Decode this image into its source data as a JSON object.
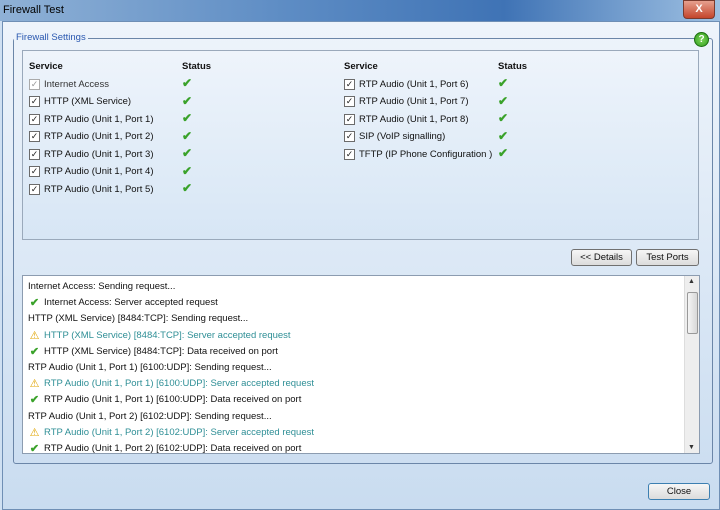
{
  "window": {
    "title": "Firewall Test",
    "close_glyph": "X"
  },
  "settings": {
    "legend": "Firewall Settings",
    "help_glyph": "?",
    "headers": {
      "service": "Service",
      "status": "Status"
    },
    "left": [
      {
        "label": "Internet Access",
        "checked": true,
        "disabled": true
      },
      {
        "label": "HTTP (XML Service)",
        "checked": true
      },
      {
        "label": "RTP Audio (Unit 1, Port 1)",
        "checked": true
      },
      {
        "label": "RTP Audio (Unit 1, Port 2)",
        "checked": true
      },
      {
        "label": "RTP Audio (Unit 1, Port 3)",
        "checked": true
      },
      {
        "label": "RTP Audio (Unit 1, Port 4)",
        "checked": true
      },
      {
        "label": "RTP Audio (Unit 1, Port 5)",
        "checked": true
      }
    ],
    "right": [
      {
        "label": "RTP Audio (Unit 1, Port 6)",
        "checked": true
      },
      {
        "label": "RTP Audio (Unit 1, Port 7)",
        "checked": true
      },
      {
        "label": "RTP Audio (Unit 1, Port 8)",
        "checked": true
      },
      {
        "label": "SIP (VoIP signalling)",
        "checked": true
      },
      {
        "label": "TFTP (IP Phone Configuration )",
        "checked": true
      }
    ]
  },
  "buttons": {
    "details": "<< Details",
    "test_ports": "Test Ports",
    "close": "Close"
  },
  "log": [
    {
      "icon": "none",
      "text": "Internet Access: Sending request..."
    },
    {
      "icon": "check",
      "text": "Internet Access: Server accepted request"
    },
    {
      "icon": "none",
      "text": "HTTP (XML Service) [8484:TCP]: Sending request..."
    },
    {
      "icon": "warning",
      "text": "HTTP (XML Service) [8484:TCP]: Server accepted request"
    },
    {
      "icon": "check",
      "text": "HTTP (XML Service) [8484:TCP]: Data received on port"
    },
    {
      "icon": "none",
      "text": "RTP Audio (Unit 1, Port 1) [6100:UDP]: Sending request..."
    },
    {
      "icon": "warning",
      "text": "RTP Audio (Unit 1, Port 1) [6100:UDP]: Server accepted request"
    },
    {
      "icon": "check",
      "text": "RTP Audio (Unit 1, Port 1) [6100:UDP]: Data received on port"
    },
    {
      "icon": "none",
      "text": "RTP Audio (Unit 1, Port 2) [6102:UDP]: Sending request..."
    },
    {
      "icon": "warning",
      "text": "RTP Audio (Unit 1, Port 2) [6102:UDP]: Server accepted request"
    },
    {
      "icon": "check",
      "text": "RTP Audio (Unit 1, Port 2) [6102:UDP]: Data received on port"
    }
  ]
}
